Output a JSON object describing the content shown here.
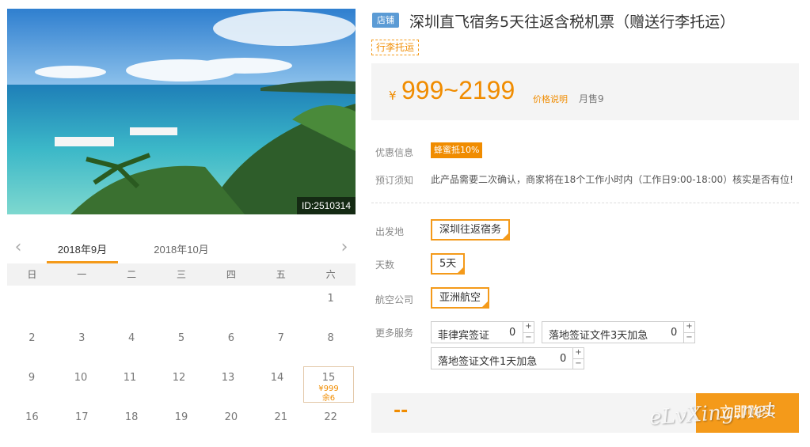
{
  "photo": {
    "id_label": "ID:2510314"
  },
  "calendar": {
    "months": [
      "2018年9月",
      "2018年10月"
    ],
    "weekdays": [
      "日",
      "一",
      "二",
      "三",
      "四",
      "五",
      "六"
    ],
    "rows": [
      [
        {
          "d": ""
        },
        {
          "d": ""
        },
        {
          "d": ""
        },
        {
          "d": ""
        },
        {
          "d": ""
        },
        {
          "d": ""
        },
        {
          "d": "1"
        }
      ],
      [
        {
          "d": "2"
        },
        {
          "d": "3"
        },
        {
          "d": "4"
        },
        {
          "d": "5"
        },
        {
          "d": "6"
        },
        {
          "d": "7"
        },
        {
          "d": "8"
        }
      ],
      [
        {
          "d": "9"
        },
        {
          "d": "10"
        },
        {
          "d": "11"
        },
        {
          "d": "12"
        },
        {
          "d": "13"
        },
        {
          "d": "14"
        },
        {
          "d": "15",
          "price": "¥999",
          "left": "余6"
        }
      ],
      [
        {
          "d": "16"
        },
        {
          "d": "17"
        },
        {
          "d": "18"
        },
        {
          "d": "19"
        },
        {
          "d": "20"
        },
        {
          "d": "21"
        },
        {
          "d": "22"
        }
      ]
    ]
  },
  "product": {
    "shop_badge": "店铺",
    "title": "深圳直飞宿务5天往返含税机票（赠送行李托运）",
    "tag": "行李托运",
    "price_symbol": "¥",
    "price": "999~2199",
    "price_note": "价格说明",
    "monthly_sales": "月售9"
  },
  "info": {
    "discount_label": "优惠信息",
    "discount_value": "蜂蜜抵10%",
    "notice_label": "预订须知",
    "notice_text": "此产品需要二次确认，商家将在18个工作小时内（工作日9:00-18:00）核实是否有位!"
  },
  "options": {
    "departure_label": "出发地",
    "departure_value": "深圳往返宿务",
    "days_label": "天数",
    "days_value": "5天",
    "airline_label": "航空公司",
    "airline_value": "亚洲航空",
    "services_label": "更多服务",
    "services": [
      {
        "name": "菲律宾签证",
        "qty": "0"
      },
      {
        "name": "落地签证文件3天加急",
        "qty": "0"
      },
      {
        "name": "落地签证文件1天加急",
        "qty": "0"
      }
    ],
    "plus": "+",
    "minus": "−"
  },
  "footer": {
    "total": "--",
    "buy_label": "立即购买"
  },
  "watermark": "eLvXing.net",
  "colors": {
    "accent": "#f49a1a",
    "badge": "#5b9bd5"
  }
}
